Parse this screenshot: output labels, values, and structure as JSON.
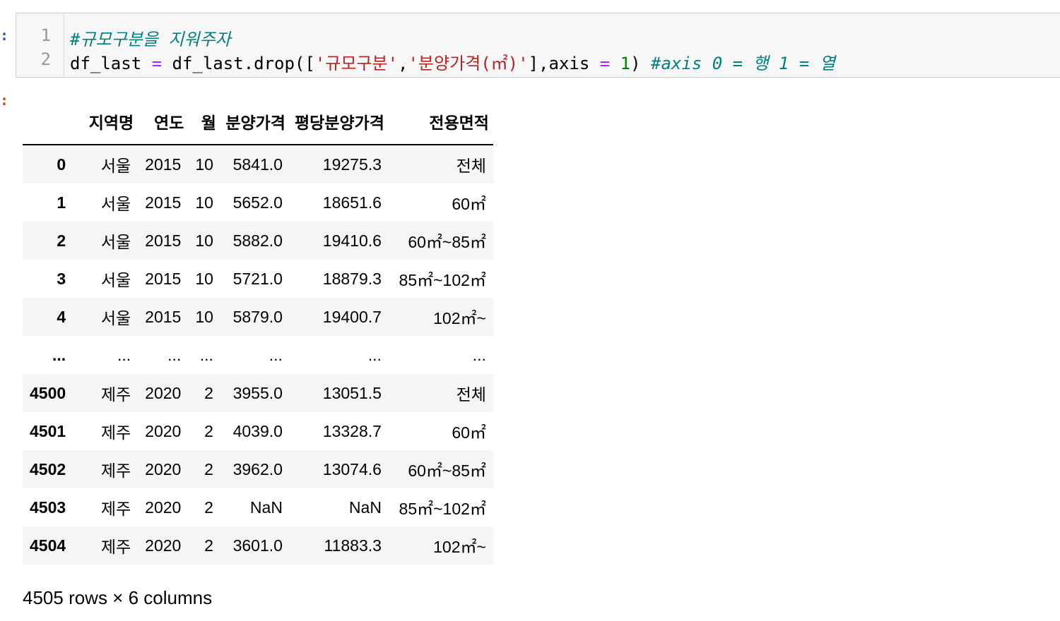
{
  "code_cell": {
    "line_numbers": [
      "1",
      "2"
    ],
    "line1": {
      "comment": "#규모구분을 지워주자"
    },
    "line2": {
      "t1": "df_last ",
      "op1": "=",
      "t2": " df_last.drop([",
      "s1": "'규모구분'",
      "t3": ",",
      "s2": "'분양가격(㎡)'",
      "t4": "],axis ",
      "op2": "=",
      "t5": " ",
      "n1": "1",
      "t6": ") ",
      "comment": "#axis 0 = 행 1 = 열"
    }
  },
  "dataframe": {
    "columns": [
      "",
      "지역명",
      "연도",
      "월",
      "분양가격",
      "평당분양가격",
      "전용면적"
    ],
    "rows": [
      [
        "0",
        "서울",
        "2015",
        "10",
        "5841.0",
        "19275.3",
        "전체"
      ],
      [
        "1",
        "서울",
        "2015",
        "10",
        "5652.0",
        "18651.6",
        "60㎡"
      ],
      [
        "2",
        "서울",
        "2015",
        "10",
        "5882.0",
        "19410.6",
        "60㎡~85㎡"
      ],
      [
        "3",
        "서울",
        "2015",
        "10",
        "5721.0",
        "18879.3",
        "85㎡~102㎡"
      ],
      [
        "4",
        "서울",
        "2015",
        "10",
        "5879.0",
        "19400.7",
        "102㎡~"
      ],
      [
        "...",
        "...",
        "...",
        "...",
        "...",
        "...",
        "..."
      ],
      [
        "4500",
        "제주",
        "2020",
        "2",
        "3955.0",
        "13051.5",
        "전체"
      ],
      [
        "4501",
        "제주",
        "2020",
        "2",
        "4039.0",
        "13328.7",
        "60㎡"
      ],
      [
        "4502",
        "제주",
        "2020",
        "2",
        "3962.0",
        "13074.6",
        "60㎡~85㎡"
      ],
      [
        "4503",
        "제주",
        "2020",
        "2",
        "NaN",
        "NaN",
        "85㎡~102㎡"
      ],
      [
        "4504",
        "제주",
        "2020",
        "2",
        "3601.0",
        "11883.3",
        "102㎡~"
      ]
    ],
    "shape_text": "4505 rows × 6 columns"
  },
  "prompt_markers": {
    "input": ":",
    "output": ":"
  },
  "colors": {
    "comment": "#008080",
    "operator": "#aa22ff",
    "string": "#ba2121",
    "number": "#008000",
    "cell_background": "#f7f7f7",
    "striped_row": "#f5f5f5"
  }
}
